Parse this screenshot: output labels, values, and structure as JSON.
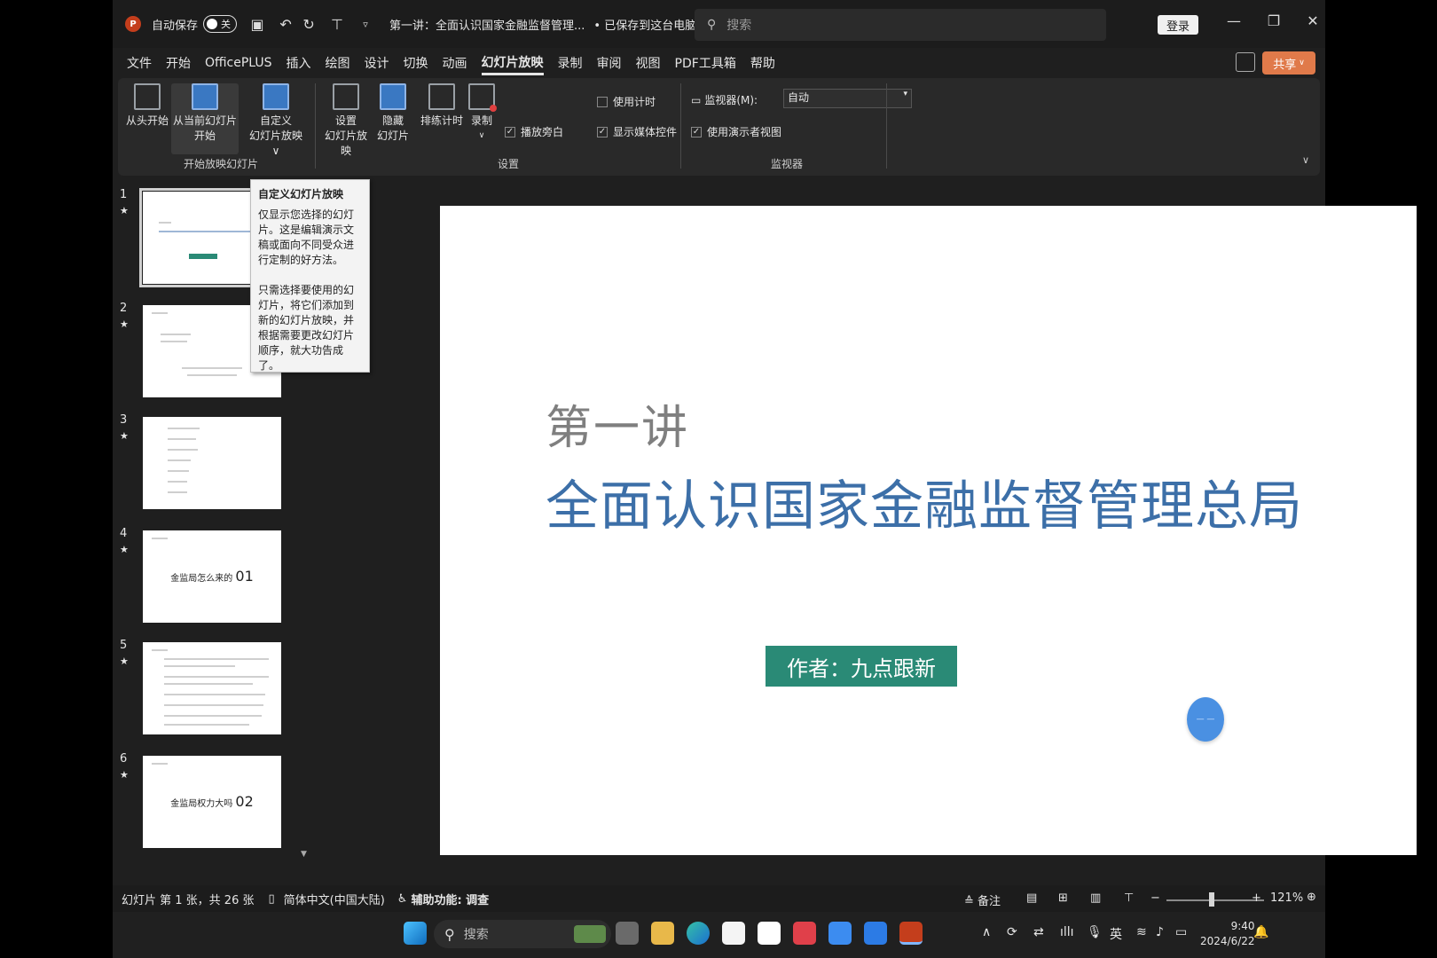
{
  "titlebar": {
    "app_badge": "P",
    "autosave_label": "自动保存",
    "autosave_state": "关",
    "doc_title": "第一讲：全面认识国家金融监督管理...",
    "saved_status": "• 已保存到这台电脑 ∨",
    "search_placeholder": "搜索",
    "login_label": "登录"
  },
  "menu": {
    "items": [
      "文件",
      "开始",
      "OfficePLUS",
      "插入",
      "绘图",
      "设计",
      "切换",
      "动画",
      "幻灯片放映",
      "录制",
      "审阅",
      "视图",
      "PDF工具箱",
      "帮助"
    ],
    "active_index": 8,
    "share_label": "共享"
  },
  "ribbon": {
    "from_start": "从头开始",
    "from_current_1": "从当前幻灯片",
    "from_current_2": "开始",
    "custom_1": "自定义",
    "custom_2": "幻灯片放映 ∨",
    "group_start": "开始放映幻灯片",
    "setup_1": "设置",
    "setup_2": "幻灯片放映",
    "hide_1": "隐藏",
    "hide_2": "幻灯片",
    "rehearse": "排练计时",
    "record": "录制",
    "use_timing": "使用计时",
    "play_narration": "播放旁白",
    "show_media": "显示媒体控件",
    "group_setup": "设置",
    "monitor_label": "监视器(M):",
    "monitor_value": "自动",
    "presenter_view": "使用演示者视图",
    "group_monitor": "监视器"
  },
  "tooltip": {
    "title": "自定义幻灯片放映",
    "para1": "仅显示您选择的幻灯片。这是编辑演示文稿或面向不同受众进行定制的好方法。",
    "para2": "只需选择要使用的幻灯片，将它们添加到新的幻灯片放映，并根据需要更改幻灯片顺序，就大功告成了。"
  },
  "thumbnails": [
    {
      "num": "1",
      "star": "★"
    },
    {
      "num": "2",
      "star": "★"
    },
    {
      "num": "3",
      "star": "★"
    },
    {
      "num": "4",
      "star": "★",
      "text": "金监局怎么来的",
      "big": "01"
    },
    {
      "num": "5",
      "star": "★"
    },
    {
      "num": "6",
      "star": "★",
      "text": "金监局权力大吗",
      "big": "02"
    }
  ],
  "slide": {
    "subtitle": "第一讲",
    "title": "全面认识国家金融监督管理总局",
    "author": "作者：九点跟新",
    "subtitle_color": "#7f7f7f",
    "title_color": "#3c6fa8",
    "author_bg": "#2a8a76"
  },
  "statusbar": {
    "slide_info": "幻灯片 第 1 张，共 26 张",
    "language": "简体中文(中国大陆)",
    "accessibility": "辅助功能: 调查",
    "notes": "备注",
    "zoom": "121%",
    "zoom_level_percent": 121
  },
  "taskbar": {
    "search_placeholder": "搜索",
    "ime": "英",
    "time": "9:40",
    "date": "2024/6/22"
  }
}
